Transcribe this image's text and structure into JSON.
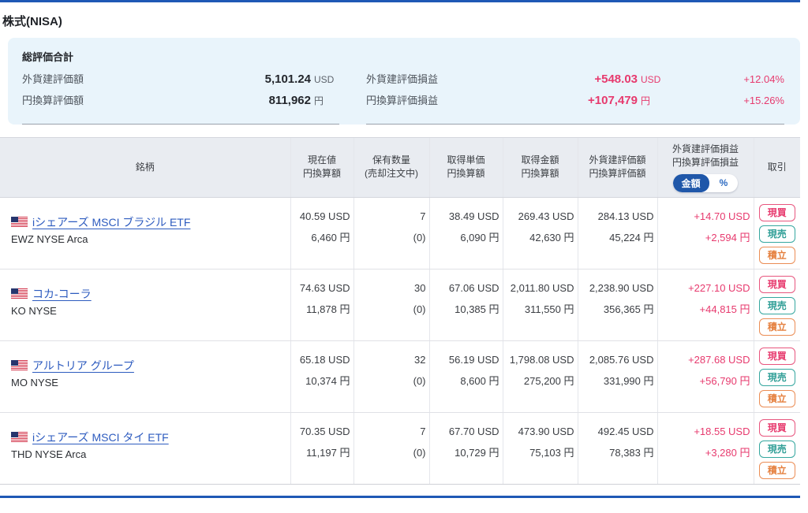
{
  "page": {
    "title": "株式(NISA)"
  },
  "colors": {
    "accent_blue": "#1e58b5",
    "link_blue": "#2d5bbf",
    "profit_pink": "#e73a6e",
    "sell_teal": "#2f9e96",
    "accumulate_orange": "#e5803f",
    "summary_bg": "#e9f4fb",
    "table_header_bg": "#e9ecf1"
  },
  "summary": {
    "title": "総評価合計",
    "rows_left": [
      {
        "label": "外貨建評価額",
        "value": "5,101.24",
        "unit": "USD"
      },
      {
        "label": "円換算評価額",
        "value": "811,962",
        "unit": "円"
      }
    ],
    "rows_right": [
      {
        "label": "外貨建評価損益",
        "value": "+548.03",
        "unit": "USD",
        "percent": "+12.04%"
      },
      {
        "label": "円換算評価損益",
        "value": "+107,479",
        "unit": "円",
        "percent": "+15.26%"
      }
    ]
  },
  "table": {
    "headers": {
      "name": "銘柄",
      "current_l1": "現在値",
      "current_l2": "円換算額",
      "qty_l1": "保有数量",
      "qty_l2": "(売却注文中)",
      "unit_l1": "取得単価",
      "unit_l2": "円換算額",
      "amount_l1": "取得金額",
      "amount_l2": "円換算額",
      "valuation_l1": "外貨建評価額",
      "valuation_l2": "円換算評価額",
      "pl_l1": "外貨建評価損益",
      "pl_l2": "円換算評価損益",
      "trade": "取引"
    },
    "pl_toggle": {
      "amount": "金額",
      "percent": "%",
      "selected": "金額"
    },
    "trade_buttons": [
      "現買",
      "現売",
      "積立"
    ],
    "rows": [
      {
        "flag": "us-flag",
        "name": "iシェアーズ MSCI ブラジル ETF",
        "ticker": "EWZ NYSE Arca",
        "current_usd": "40.59 USD",
        "current_jpy": "6,460 円",
        "qty": "7",
        "qty_order": "(0)",
        "unit_usd": "38.49 USD",
        "unit_jpy": "6,090 円",
        "amount_usd": "269.43 USD",
        "amount_jpy": "42,630 円",
        "valuation_usd": "284.13 USD",
        "valuation_jpy": "45,224 円",
        "pl_usd": "+14.70 USD",
        "pl_jpy": "+2,594 円"
      },
      {
        "flag": "us-flag",
        "name": "コカ-コーラ",
        "ticker": "KO NYSE",
        "current_usd": "74.63 USD",
        "current_jpy": "11,878 円",
        "qty": "30",
        "qty_order": "(0)",
        "unit_usd": "67.06 USD",
        "unit_jpy": "10,385 円",
        "amount_usd": "2,011.80 USD",
        "amount_jpy": "311,550 円",
        "valuation_usd": "2,238.90 USD",
        "valuation_jpy": "356,365 円",
        "pl_usd": "+227.10 USD",
        "pl_jpy": "+44,815 円"
      },
      {
        "flag": "us-flag",
        "name": "アルトリア グループ",
        "ticker": "MO NYSE",
        "current_usd": "65.18 USD",
        "current_jpy": "10,374 円",
        "qty": "32",
        "qty_order": "(0)",
        "unit_usd": "56.19 USD",
        "unit_jpy": "8,600 円",
        "amount_usd": "1,798.08 USD",
        "amount_jpy": "275,200 円",
        "valuation_usd": "2,085.76 USD",
        "valuation_jpy": "331,990 円",
        "pl_usd": "+287.68 USD",
        "pl_jpy": "+56,790 円"
      },
      {
        "flag": "us-flag",
        "name": "iシェアーズ MSCI タイ ETF",
        "ticker": "THD NYSE Arca",
        "current_usd": "70.35 USD",
        "current_jpy": "11,197 円",
        "qty": "7",
        "qty_order": "(0)",
        "unit_usd": "67.70 USD",
        "unit_jpy": "10,729 円",
        "amount_usd": "473.90 USD",
        "amount_jpy": "75,103 円",
        "valuation_usd": "492.45 USD",
        "valuation_jpy": "78,383 円",
        "pl_usd": "+18.55 USD",
        "pl_jpy": "+3,280 円"
      }
    ]
  }
}
